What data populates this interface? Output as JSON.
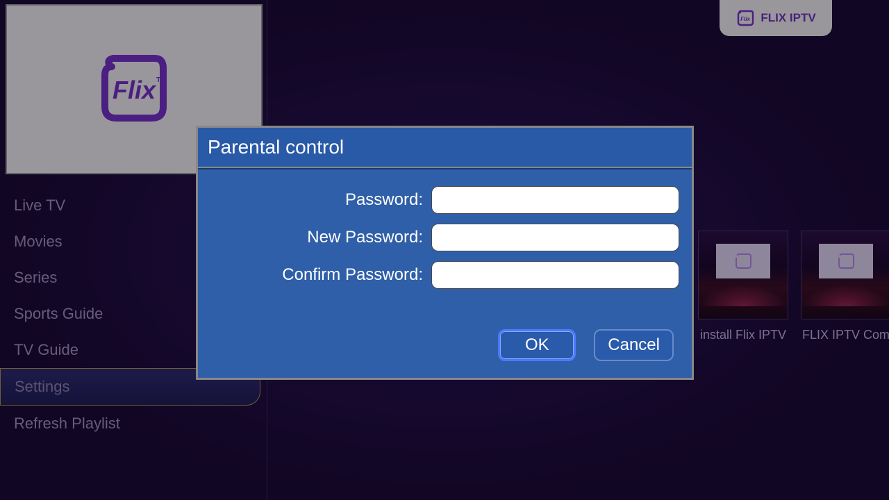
{
  "brand": {
    "logo_text": "Flix",
    "badge_text": "FLIX IPTV"
  },
  "sidebar": {
    "items": [
      {
        "label": "Live TV",
        "selected": false
      },
      {
        "label": "Movies",
        "selected": false
      },
      {
        "label": "Series",
        "selected": false
      },
      {
        "label": "Sports Guide",
        "selected": false
      },
      {
        "label": "TV Guide",
        "selected": false
      },
      {
        "label": "Settings",
        "selected": true
      },
      {
        "label": "Refresh Playlist",
        "selected": false
      }
    ]
  },
  "thumbs": [
    {
      "label": "install Flix IPTV"
    },
    {
      "label": "FLIX IPTV Com"
    }
  ],
  "dialog": {
    "title": "Parental control",
    "fields": {
      "password_label": "Password:",
      "password_value": "",
      "new_password_label": "New Password:",
      "new_password_value": "",
      "confirm_password_label": "Confirm Password:",
      "confirm_password_value": ""
    },
    "buttons": {
      "ok": "OK",
      "cancel": "Cancel"
    }
  }
}
